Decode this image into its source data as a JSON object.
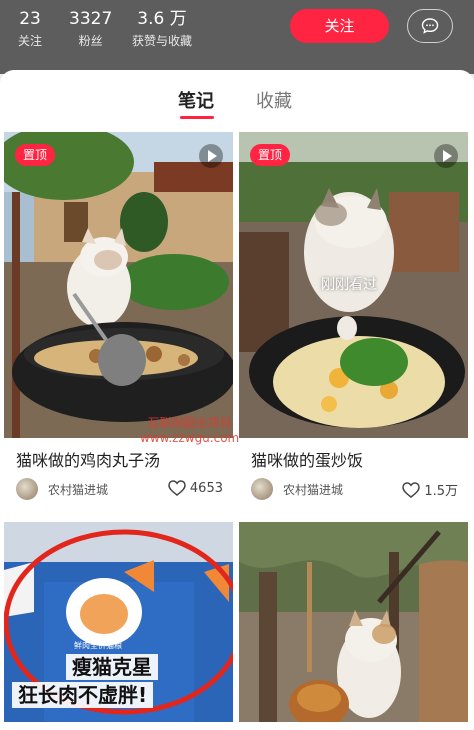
{
  "header": {
    "stats": [
      {
        "value": "23",
        "label": "关注"
      },
      {
        "value": "3327",
        "label": "粉丝"
      },
      {
        "value": "3.6 万",
        "label": "获赞与收藏"
      }
    ],
    "follow_label": "关注",
    "message_icon": "chat-bubble-icon"
  },
  "tabs": [
    {
      "label": "笔记",
      "active": true
    },
    {
      "label": "收藏",
      "active": false
    }
  ],
  "notes": [
    {
      "badge": "置顶",
      "title": "猫咪做的鸡肉丸子汤",
      "author": "农村猫进城",
      "likes": "4653"
    },
    {
      "badge": "置顶",
      "overlay": "刚刚看过",
      "title": "猫咪做的蛋炒饭",
      "author": "农村猫进城",
      "likes": "1.5万"
    },
    {
      "caption_line1": "瘦猫克星",
      "caption_line2": "狂长肉不虚胖!",
      "bag_label": "鲜肉全价猫粮"
    },
    {}
  ],
  "watermark": {
    "line1": "互联网副业项目",
    "line2": "www.zzwgu.com"
  },
  "colors": {
    "accent": "#ff2442",
    "header_bg": "#5d5d5d"
  }
}
